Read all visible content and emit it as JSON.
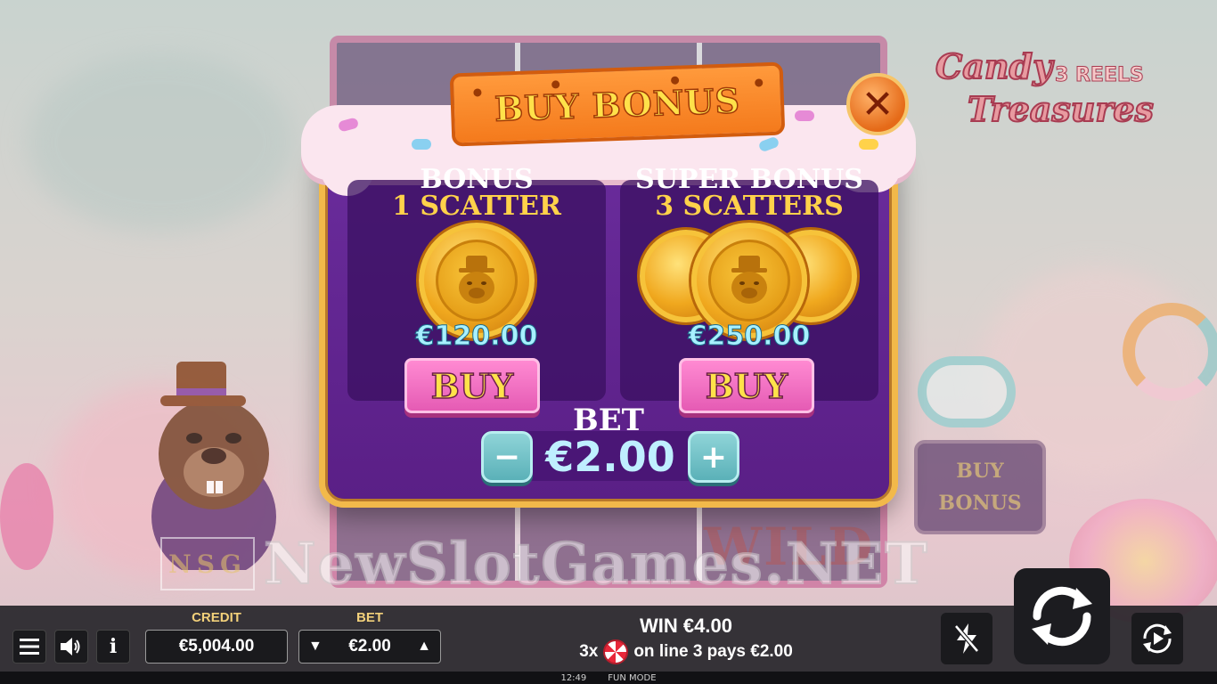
{
  "game": {
    "logo_line1": "Candy",
    "logo_number": "3",
    "logo_reels": "REELS",
    "logo_line2": "Treasures",
    "background_symbol": "WILD",
    "side_buy_bonus_line1": "BUY",
    "side_buy_bonus_line2": "BONUS"
  },
  "watermark": {
    "badge": "NSG",
    "text": "NewSlotGames.NET"
  },
  "buy_bonus_dialog": {
    "title": "BUY BONUS",
    "close_icon": "close-icon",
    "options": [
      {
        "line1": "BONUS",
        "line2": "1 SCATTER",
        "price": "€120.00",
        "buy_label": "BUY",
        "coins": 1
      },
      {
        "line1": "SUPER BONUS",
        "line2": "3 SCATTERS",
        "price": "€250.00",
        "buy_label": "BUY",
        "coins": 3
      }
    ],
    "bet_label": "BET",
    "bet_value": "€2.00",
    "decrease_icon": "minus-icon",
    "increase_icon": "plus-icon"
  },
  "bottom_bar": {
    "menu_icon": "hamburger-menu-icon",
    "sound_icon": "speaker-icon",
    "info_icon": "info-icon",
    "credit_label": "CREDIT",
    "credit_value": "€5,004.00",
    "bet_label": "BET",
    "bet_value": "€2.00",
    "win_text": "WIN €4.00",
    "pay_count": "3x",
    "pay_symbol": "lollipop-icon",
    "pay_text": "on line 3 pays €2.00",
    "turbo_icon": "turbo-off-icon",
    "spin_icon": "spin-icon",
    "autoplay_icon": "autoplay-icon"
  },
  "footer": {
    "time": "12:49",
    "mode": "FUN MODE"
  },
  "colors": {
    "modal_purple": "#6a2c9c",
    "modal_border_gold": "#f2b94a",
    "buy_pink": "#ff8ad2",
    "buy_text_yellow": "#ffe24a",
    "price_cyan": "#a8f0ff",
    "bet_step_teal": "#8fd4d8",
    "bar_label_gold": "#f2d07a"
  }
}
